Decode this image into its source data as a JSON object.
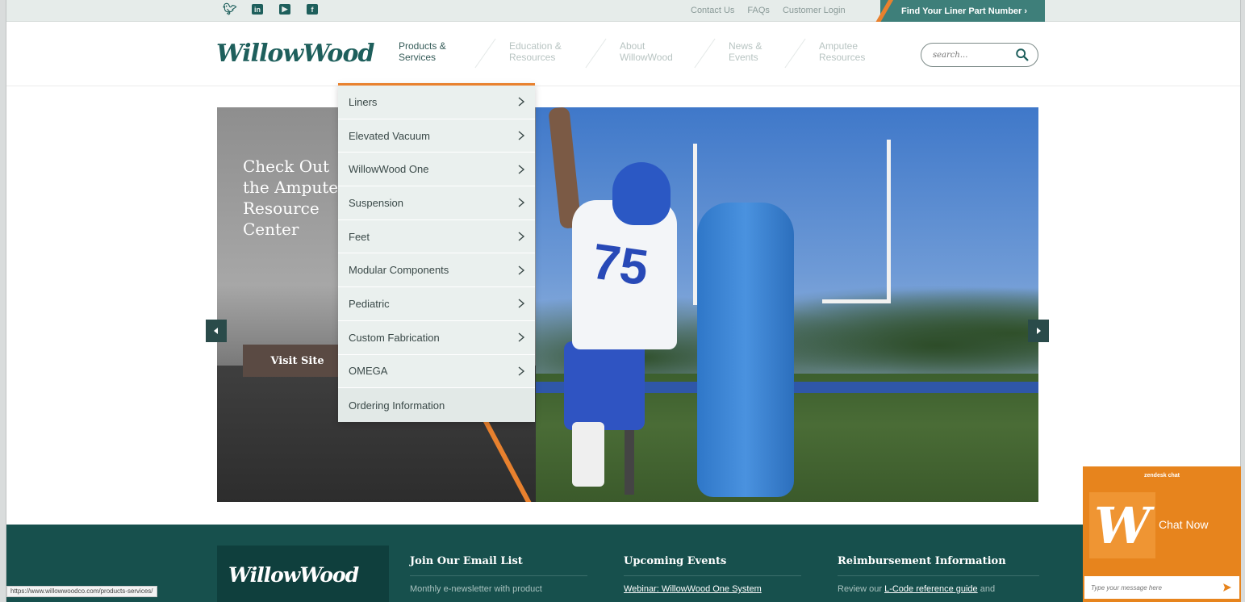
{
  "topbar": {
    "social": [
      "twitter-icon",
      "linkedin-icon",
      "youtube-icon",
      "facebook-icon"
    ],
    "links": [
      "Contact Us",
      "FAQs",
      "Customer Login"
    ],
    "find_part": "Find Your Liner Part Number ›"
  },
  "header": {
    "logo": "WillowWood",
    "nav": [
      {
        "line1": "Products &",
        "line2": "Services"
      },
      {
        "line1": "Education &",
        "line2": "Resources"
      },
      {
        "line1": "About",
        "line2": "WillowWood"
      },
      {
        "line1": "News &",
        "line2": "Events"
      },
      {
        "line1": "Amputee",
        "line2": "Resources"
      }
    ],
    "search_placeholder": "search..."
  },
  "dropdown": {
    "items": [
      "Liners",
      "Elevated Vacuum",
      "WillowWood One",
      "Suspension",
      "Feet",
      "Modular Components",
      "Pediatric",
      "Custom Fabrication",
      "OMEGA",
      "Ordering Information"
    ]
  },
  "hero": {
    "heading": "Check Out the Amputee Resource Center",
    "button": "Visit Site",
    "jersey_number": "75"
  },
  "footer": {
    "logo": "WillowWood",
    "email": {
      "title": "Join Our Email List",
      "text": "Monthly e-newsletter with product"
    },
    "events": {
      "title": "Upcoming Events",
      "link": "Webinar: WillowWood One System"
    },
    "reimb": {
      "title": "Reimbursement Information",
      "text": "Review our ",
      "link": "L-Code reference guide",
      "after": " and"
    }
  },
  "status_url": "https://www.willowwoodco.com/products-services/",
  "chat": {
    "title": "zendesk chat",
    "logo_letter": "W",
    "label": "Chat Now",
    "placeholder": "Type your message here"
  },
  "colors": {
    "brand_teal": "#1e5f5c",
    "accent_orange": "#e8812e",
    "chat_orange": "#e7841d",
    "footer_teal": "#17504d"
  }
}
